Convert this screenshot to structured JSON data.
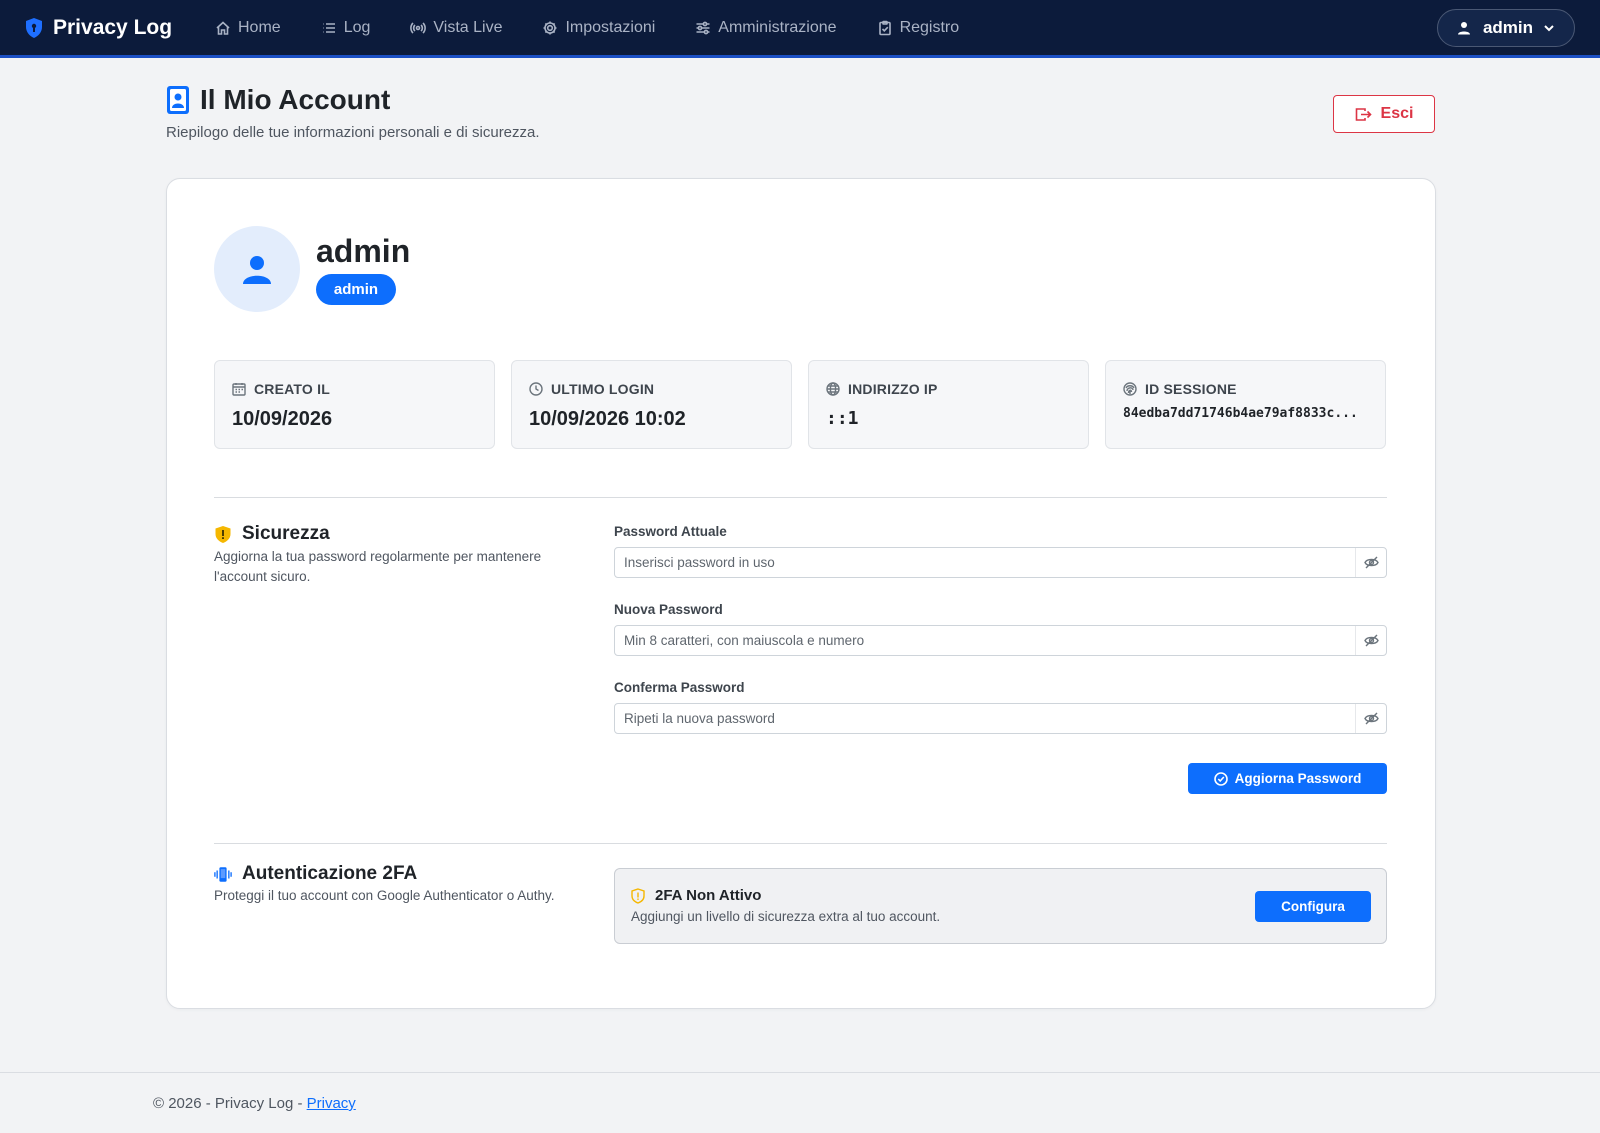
{
  "nav": {
    "brand": "Privacy Log",
    "items": [
      {
        "label": "Home",
        "icon": "home-icon"
      },
      {
        "label": "Log",
        "icon": "list-icon"
      },
      {
        "label": "Vista Live",
        "icon": "broadcast-icon"
      },
      {
        "label": "Impostazioni",
        "icon": "gear-icon"
      },
      {
        "label": "Amministrazione",
        "icon": "sliders-icon"
      },
      {
        "label": "Registro",
        "icon": "clipboard-icon"
      }
    ],
    "user": "admin"
  },
  "header": {
    "title": "Il Mio Account",
    "subtitle": "Riepilogo delle tue informazioni personali e di sicurezza.",
    "logout_label": "Esci"
  },
  "profile": {
    "username": "admin",
    "role": "admin"
  },
  "stats": [
    {
      "label": "CREATO IL",
      "value": "10/09/2026",
      "icon": "calendar-icon"
    },
    {
      "label": "ULTIMO LOGIN",
      "value": "10/09/2026 10:02",
      "icon": "clock-icon"
    },
    {
      "label": "INDIRIZZO IP",
      "value": "::1",
      "icon": "globe-icon"
    },
    {
      "label": "ID SESSIONE",
      "value": "84edba7dd71746b4ae79af8833c...",
      "icon": "fingerprint-icon"
    }
  ],
  "security": {
    "title": "Sicurezza",
    "description": "Aggiorna la tua password regolarmente per mantenere l'account sicuro.",
    "fields": [
      {
        "label": "Password Attuale",
        "placeholder": "Inserisci password in uso"
      },
      {
        "label": "Nuova Password",
        "placeholder": "Min 8 caratteri, con maiuscola e numero"
      },
      {
        "label": "Conferma Password",
        "placeholder": "Ripeti la nuova password"
      }
    ],
    "submit_label": "Aggiorna Password"
  },
  "twofa": {
    "title": "Autenticazione 2FA",
    "description": "Proteggi il tuo account con Google Authenticator o Authy.",
    "status_title": "2FA Non Attivo",
    "status_desc": "Aggiungi un livello di sicurezza extra al tuo account.",
    "button_label": "Configura"
  },
  "footer": {
    "text": "© 2026 - Privacy Log - ",
    "link": "Privacy"
  },
  "colors": {
    "navbar": "#0c1b3b",
    "primary": "#0d6efd",
    "danger": "#dc3545",
    "warning": "#f5b700"
  }
}
